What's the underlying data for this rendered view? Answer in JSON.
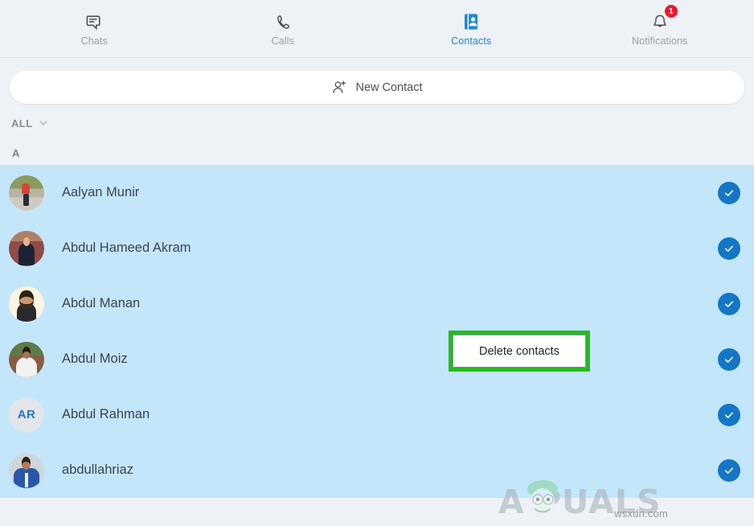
{
  "app": {
    "accent_color": "#1476c6",
    "selected_row_color": "#c3e6fb",
    "page_background": "#eef1f6",
    "highlight_color": "#26bb20"
  },
  "tabbar": {
    "tabs": [
      {
        "id": "chats",
        "label": "Chats",
        "icon": "chat-bubble-icon",
        "active": false
      },
      {
        "id": "calls",
        "label": "Calls",
        "icon": "phone-handset-icon",
        "active": false
      },
      {
        "id": "contacts",
        "label": "Contacts",
        "icon": "contact-card-icon",
        "active": true
      },
      {
        "id": "notifications",
        "label": "Notifications",
        "icon": "bell-icon",
        "active": false,
        "badge": "1"
      }
    ]
  },
  "new_contact": {
    "label": "New Contact",
    "icon": "person-plus-icon"
  },
  "filter": {
    "label": "ALL",
    "icon": "chevron-down-icon"
  },
  "section": {
    "letter": "A"
  },
  "contacts": [
    {
      "name": "Aalyan Munir",
      "avatar_type": "photo",
      "photo_class": "ph1",
      "selected": true
    },
    {
      "name": "Abdul Hameed Akram",
      "avatar_type": "photo",
      "photo_class": "ph2",
      "selected": true
    },
    {
      "name": "Abdul Manan",
      "avatar_type": "photo",
      "photo_class": "ph3",
      "selected": true
    },
    {
      "name": "Abdul Moiz",
      "avatar_type": "photo",
      "photo_class": "ph4",
      "selected": true
    },
    {
      "name": "Abdul Rahman",
      "avatar_type": "initials",
      "initials": "AR",
      "selected": true
    },
    {
      "name": "abdullahriaz",
      "avatar_type": "photo",
      "photo_class": "ph5",
      "selected": true
    }
  ],
  "delete_tooltip": {
    "label": "Delete contacts"
  },
  "watermark": {
    "brand": "A  PUALS",
    "site": "wsxdn.com"
  }
}
